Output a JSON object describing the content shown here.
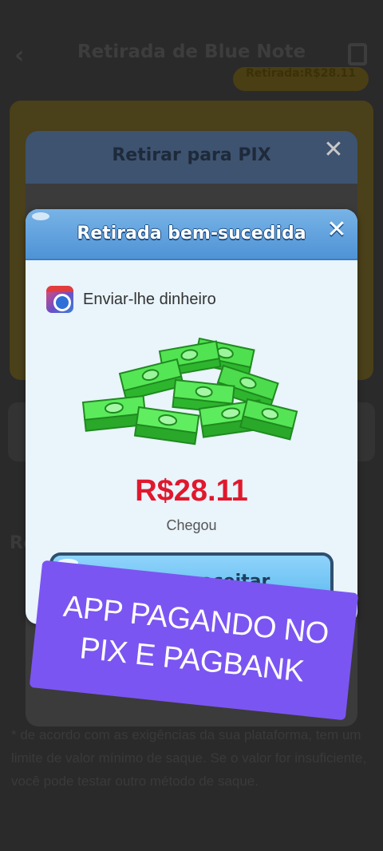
{
  "background": {
    "title": "Retirada de Blue Note",
    "badge": "Retirada:R$28.11",
    "section_heading": "Re",
    "note": "* de acordo com as exigências da sua plataforma, tem um limite de valor mínimo de saque. Se o valor for insuficiente, você pode testar outro método de saque."
  },
  "pix_modal": {
    "title": "Retirar para PIX"
  },
  "success_modal": {
    "title": "Retirada bem-sucedida",
    "app_label": "Enviar-lhe dinheiro",
    "amount": "R$28.11",
    "status": "Chegou",
    "accept_label": "Feliz em aceitar"
  },
  "promo": {
    "text": "APP PAGANDO NO\nPIX E PAGBANK"
  },
  "icons": {
    "back": "back-arrow-icon",
    "clipboard": "clipboard-icon",
    "close": "close-icon",
    "app": "app-icon",
    "cash": "cash-stack-icon"
  },
  "colors": {
    "amount": "#e0182d",
    "header_blue": "#4f93d6",
    "button_blue": "#58b8ee",
    "promo_purple": "#7b55f2",
    "cash_green": "#3fd23f"
  }
}
